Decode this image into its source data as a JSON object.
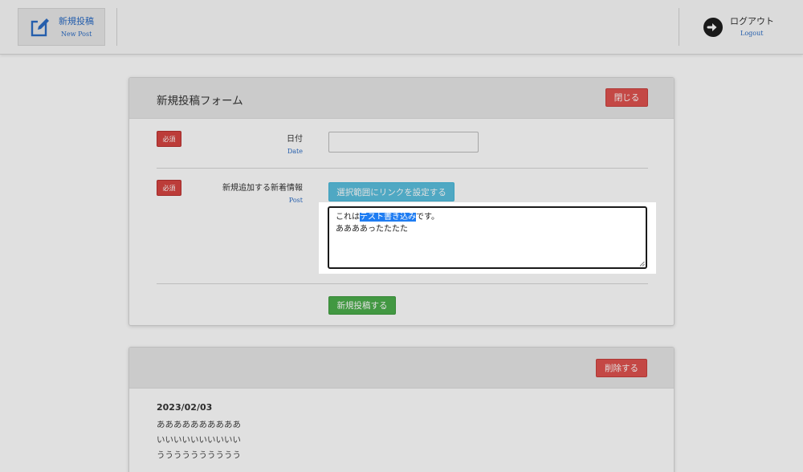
{
  "header": {
    "new_post": {
      "title": "新規投稿",
      "subtitle": "New Post",
      "icon": "edit-icon"
    },
    "logout": {
      "title": "ログアウト",
      "subtitle": "Logout",
      "icon": "arrow-right-circle-icon"
    }
  },
  "form": {
    "title": "新規投稿フォーム",
    "close_label": "閉じる",
    "required_badge": "必須",
    "date_label": "日付",
    "date_sublabel": "Date",
    "date_value": "",
    "post_label": "新規追加する新着情報",
    "post_sublabel": "Post",
    "link_button_label": "選択範囲にリンクを設定する",
    "textarea": {
      "line1_before": "これは",
      "line1_selected": "テスト書き込み",
      "line1_after": "です。",
      "line2": "ああああったたたた"
    },
    "submit_label": "新規投稿する"
  },
  "post": {
    "delete_label": "削除する",
    "date": "2023/02/03",
    "lines": [
      "ああああああああああ",
      "いいいいいいいいいい",
      "うううううううううう"
    ]
  },
  "colors": {
    "danger": "#e0524f",
    "info": "#5bc0de",
    "success": "#4cae4c",
    "link": "#2b6cc4",
    "selection": "#1e7cf2"
  }
}
